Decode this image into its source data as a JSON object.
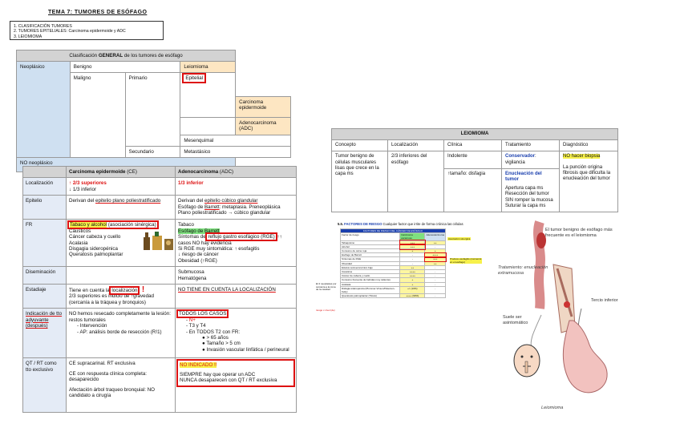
{
  "header": {
    "title": "TEMA 7: TUMORES DE ESÓFAGO"
  },
  "toc": {
    "items": [
      "1. CLASIFICACIÓN TUMORES",
      "2. TUMORES EPITELIALES: Carcinoma epidermoide y ADC",
      "3. LEIOMIOMA"
    ]
  },
  "general": {
    "title_pre": "Clasificación ",
    "title_bold": "GENERAL",
    "title_post": " de los tumores de esófago",
    "neoplasico": "Neoplásico",
    "benigno": "Benigno",
    "leiomioma": "Leiomioma",
    "maligno": "Maligno",
    "primario": "Primario",
    "epitelial": "Epitelial",
    "carcinoma": "Carcinoma epidermoide",
    "adc": "Adenocarcinoma (ADC)",
    "mesenquimal": "Mesenquimal",
    "secundario": "Secundario",
    "metastasico": "Metastásico",
    "no_neo": "NO neoplásico"
  },
  "compare": {
    "col_ce": "Carcinoma epidermoide",
    "col_ce_tag": " (CE)",
    "col_adc": "Adenocarcinoma",
    "col_adc_tag": " (ADC)",
    "rows": {
      "loc": {
        "label": "Localización",
        "ce1": "↑ 2/3 superiores",
        "ce2": "↓ 1/3 inferior",
        "adc": "1/3 inferior"
      },
      "epi": {
        "label": "Epitelio",
        "ce_pre": "Derivan del ",
        "ce_u": "epitelio plano poliestratificado",
        "adc1_pre": "Derivan del ",
        "adc1_u": "epitelio cúbico glandular",
        "adc2_pre": "Esófago de ",
        "adc2_u": "Barrett",
        "adc2_post": ": metaplasia. Preneoplásica",
        "adc3": "Plano poliestratificado → cúbico glandular"
      },
      "fr": {
        "label": "FR",
        "ce_box": "Tabaco y alcohol",
        "ce_box2": " (asociación sinérgica)",
        "ce_list": [
          "Cáusticos",
          "Cáncer cabeza y cuello",
          "Acalasia",
          "Disgagia sideropénica",
          "Queratosis palmoplantar"
        ],
        "adc1": "Tabaco",
        "adc2": "Esófago de Barrett",
        "adc3_pre": "Síntomas de ",
        "adc3_box": "reflujo gastro esofágico (RGE)",
        "adc3_post": " ↑↑",
        "adc4": "casos NO hay evidencia",
        "adc5": "Si RGE muy sintomática: ↑ esofagitis",
        "adc6": "↓ riesgo de cáncer",
        "adc7": "Obesidad (↑RGE)"
      },
      "dis": {
        "label": "Diseminación",
        "adc1": "Submucosa",
        "adc2": "Hematógena"
      },
      "est": {
        "label": "Estadiaje",
        "ce_pre": "Tiene en cuenta la ",
        "ce_box": "localización",
        "ce_post": ":",
        "ce2": "2/3 superiores es indicio de ↑gravedad",
        "ce3": "(cercanía a la tráquea y bronquios)",
        "adc": "NO TIENE EN CUENTA LA LOCALIZACIÓN"
      },
      "ind": {
        "label": "Indicación de tto adyuvante (después)",
        "ce1": "NO hemos resecado completamente la lesión: restos tumorales",
        "ce2": "Intervención",
        "ce3": "AP: análisis borde de resección (R!1)",
        "adc_box": "TODOS LOS CASOS",
        "adc2": "N+",
        "adc3": "T3 y T4",
        "adc4": "En TODOS T2 con FR:",
        "adc5": "> 65 años",
        "adc6": "Tamaño > 5 cm",
        "adc7": "Invasión vascular linfática / perineural"
      },
      "qt": {
        "label": "QT / RT como tto exclusivo",
        "ce1": "CE supracarinal. RT exclusiva",
        "ce2": "CE con respuesta clínica completa: desaparecido",
        "ce3": "Afectación árbol traqueo bronquial: NO candidato a cirugía",
        "adc1": "NO INDICADO !!",
        "adc2": "SIEMPRE hay que operar un ADC",
        "adc3": "NUNCA desaparecen con QT / RT exclusiva"
      }
    }
  },
  "leio": {
    "title": "LEIOMIOMA",
    "headers": [
      "Concepto",
      "Localización",
      "Clínica",
      "Tratamiento",
      "Diagnóstico"
    ],
    "concepto": "Tumor benigno de células musculares lisas que crece en la capa ms",
    "localizacion": "2/3 inferiores del esófago",
    "clinica1": "Indolente",
    "clinica2": "↑tamaño: disfagia",
    "trat1_b": "Conservador",
    "trat1": ": vigilancia",
    "trat2_b": "Enucleación del tumor",
    "trat3": [
      "Apertura capa ms",
      "Resección del tumor",
      "SIN romper la mucosa",
      "Suturar la capa ms"
    ],
    "diag1": "NO hacer biopsia",
    "diag2": "La punción origina fibrosis que dificulta la enucleación del tumor"
  },
  "fr_figure": {
    "num": "5.5.",
    "title": "FACTORES DE RIESGO",
    "subtitle": "Cualquier factor que irrite de forma crónica las células",
    "table_title": "FACTORES DE RIESGO DEL CÁNCER DE ESÓFAGO",
    "col1": "Factor de riesgo",
    "col2": "Carcinoma escamoso",
    "col3": "Adenocarcinoma",
    "rows": [
      "Tabaquismo",
      "Alcohol",
      "Consumo de carne roja",
      "Esófago de Barrett",
      "Síntomas de RGE",
      "Obesidad",
      "Estatus socioeconómico bajo",
      "Cáusticos",
      "Cáncer de cabeza y cuello",
      "Consumo frecuente de bebidas muy calientes",
      "Acalasia",
      "Disfagia sideropénica (Plummer-Vinson/Paterson-Kelly)",
      "Queratosis palmoplantar (Tilosis)"
    ],
    "v_sq": [
      "+++",
      "+++",
      "+",
      "-",
      "-",
      "-",
      "++",
      "++++",
      "++++",
      "+",
      "+",
      "+/- (10%)",
      "++++ (90%)"
    ],
    "v_ad": [
      "++",
      "-",
      "+",
      "++++",
      "+++",
      "++",
      "-",
      "-",
      "-",
      "-",
      "-",
      "-",
      "-"
    ],
    "note1": "Asociación sinergica",
    "note2": "Produce esofagitis (comienza en el esófago)",
    "side1": "El 4 neoplasias por cercanía a la zona de la cavidad",
    "side2": "riesgo x nivel (de)"
  },
  "illu": {
    "cap1": "El tumor benigno de esófago más frecuente es el leiomioma",
    "cap2": "Tratamiento: enucleación extramucosa",
    "cap3": "Tercio inferior",
    "cap4": "Suele ser asintomático",
    "cap5": "Leiomioma"
  },
  "colors": {
    "red": "#d11111",
    "blue_header": "#cfe0f1",
    "orange": "#fde6c2",
    "yellow": "#f7f14a",
    "green": "#7fe07f"
  }
}
